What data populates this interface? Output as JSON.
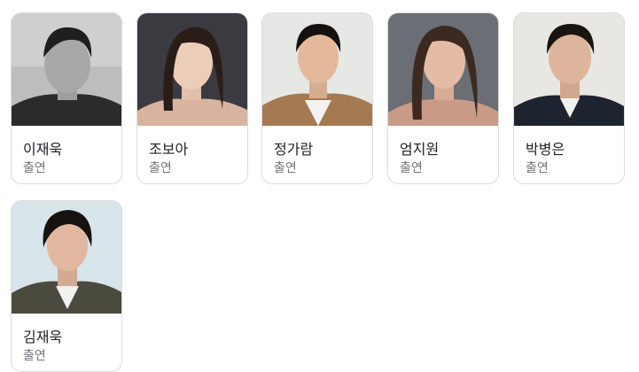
{
  "cast": [
    {
      "name": "이재욱",
      "role": "출연"
    },
    {
      "name": "조보아",
      "role": "출연"
    },
    {
      "name": "정가람",
      "role": "출연"
    },
    {
      "name": "엄지원",
      "role": "출연"
    },
    {
      "name": "박병은",
      "role": "출연"
    },
    {
      "name": "김재욱",
      "role": "출연"
    }
  ]
}
